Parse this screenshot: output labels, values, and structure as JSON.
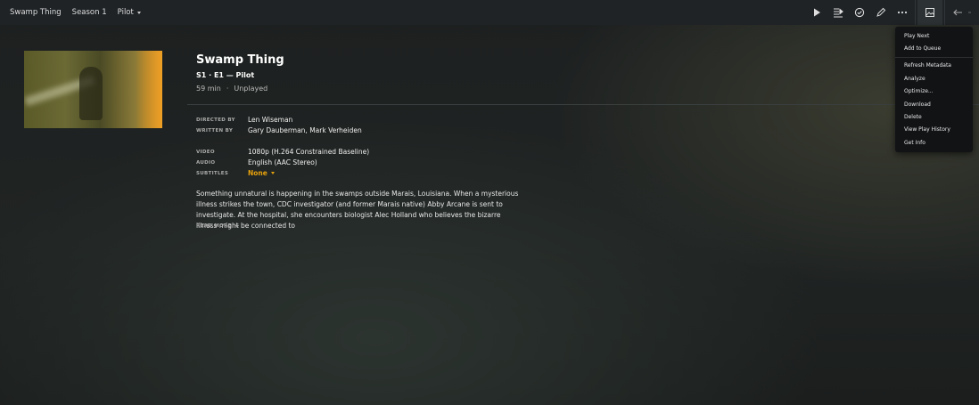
{
  "breadcrumb": {
    "show": "Swamp Thing",
    "season": "Season 1",
    "episode": "Pilot"
  },
  "toolbar": {
    "icons": [
      "play-icon",
      "play-next-icon",
      "mark-watched-icon",
      "edit-icon",
      "more-icon",
      "poster-icon",
      "back-icon"
    ]
  },
  "episode": {
    "title": "Swamp Thing",
    "subtitle": "S1 · E1 — Pilot",
    "duration": "59 min",
    "status": "Unplayed"
  },
  "details": {
    "directed_by_label": "DIRECTED BY",
    "directed_by": "Len Wiseman",
    "written_by_label": "WRITTEN BY",
    "written_by": "Gary Dauberman, Mark Verheiden",
    "video_label": "VIDEO",
    "video": "1080p (H.264 Constrained Baseline)",
    "audio_label": "AUDIO",
    "audio": "English (AAC Stereo)",
    "subtitles_label": "SUBTITLES",
    "subtitles": "None"
  },
  "summary": {
    "text": "Something unnatural is happening in the swamps outside Marais, Louisiana. When a mysterious illness strikes the town, CDC investigator (and former Marais native) Abby Arcane is sent to investigate. At the hospital, she encounters biologist Alec Holland who believes the bizarre illness might be connected to",
    "read_more": "READ MORE"
  },
  "menu": {
    "group1": [
      "Play Next",
      "Add to Queue"
    ],
    "group2": [
      "Refresh Metadata",
      "Analyze",
      "Optimize...",
      "Download",
      "Delete",
      "View Play History",
      "Get Info"
    ]
  },
  "colors": {
    "accent": "#e5a00d",
    "topbar": "#1f2326",
    "menu_bg": "#111315"
  }
}
